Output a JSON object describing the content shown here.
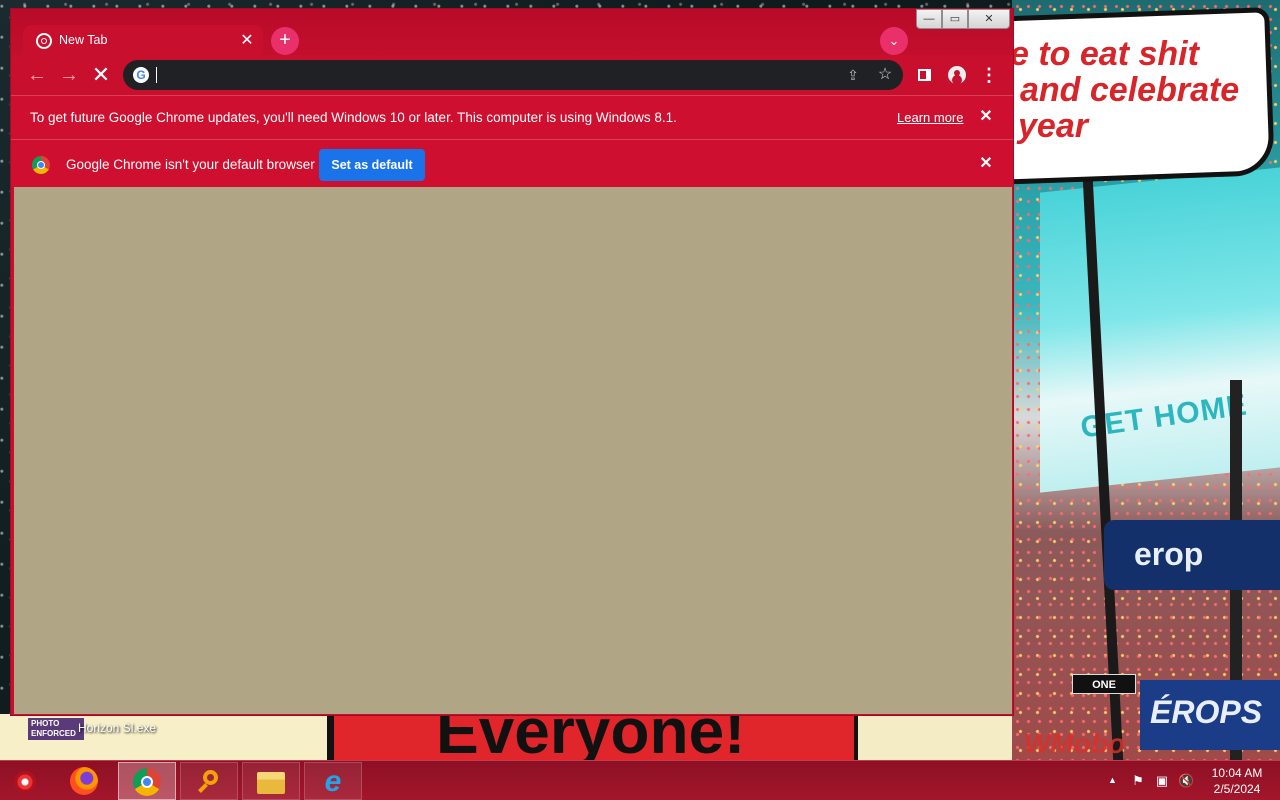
{
  "wallpaper": {
    "bubble_lines": [
      "e to eat shit",
      "and celebrate",
      "year"
    ],
    "billboard_text": "GET HOME",
    "sign1": "erop",
    "sign2": "ÉROPS",
    "oneway": "ONE",
    "comic_text": "Everyone!",
    "photo_sign": "PHOTO ENFORCED",
    "watermark": "WMobo"
  },
  "desktop": {
    "icon_label": "Horizon Sl.exe"
  },
  "window": {
    "controls": {
      "minimize": "—",
      "maximize": "▭",
      "close": "✕"
    }
  },
  "tabs": [
    {
      "title": "New Tab",
      "close": "✕",
      "icon": "loading-favicon-icon"
    }
  ],
  "tabstrip": {
    "new_tab": "+",
    "tab_search": "⌄"
  },
  "toolbar": {
    "back": "←",
    "forward": "→",
    "stop": "✕",
    "omnibox": {
      "value": "",
      "placeholder": ""
    },
    "menu": "⋮"
  },
  "infobars": {
    "update": {
      "text": "To get future Google Chrome updates, you'll need Windows 10 or later. This computer is using Windows 8.1.",
      "link": "Learn more",
      "close": "✕"
    },
    "default_browser": {
      "text": "Google Chrome isn't your default browser",
      "button": "Set as default",
      "close": "✕"
    }
  },
  "page": {
    "background": "#b0a585"
  },
  "taskbar": {
    "apps": [
      "Firefox",
      "Google Chrome",
      "Search",
      "File Explorer",
      "Internet Explorer"
    ],
    "active_app": "Google Chrome",
    "tray_arrow": "▲",
    "clock": {
      "time": "10:04 AM",
      "date": "2/5/2024"
    }
  },
  "colors": {
    "chrome_frame": "#c8102e",
    "omnibox": "#202124",
    "button_blue": "#1a73e8",
    "taskbar": "#a3162c"
  }
}
